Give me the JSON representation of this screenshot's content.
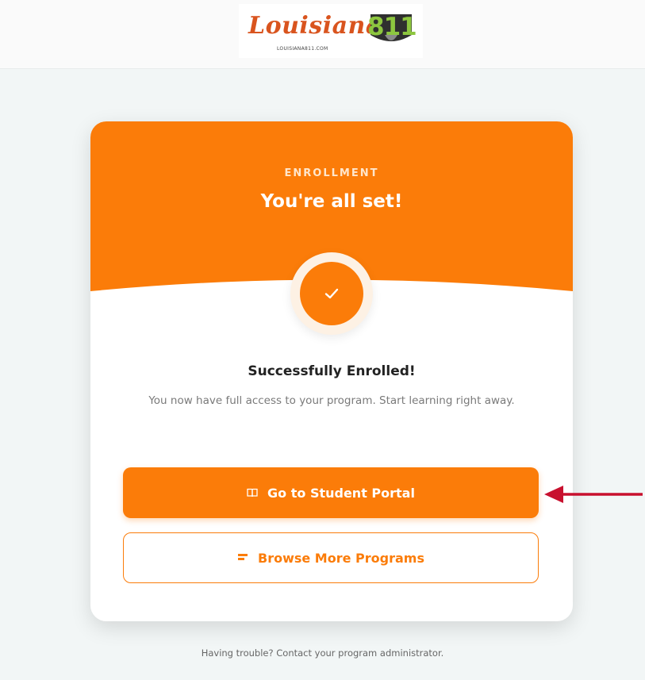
{
  "brand": {
    "logo_text": "Louisiana",
    "logo_badge": "811",
    "logo_url": "LOUISIANA811.COM"
  },
  "card": {
    "eyebrow": "ENROLLMENT",
    "title": "You're all set!",
    "success_title": "Successfully Enrolled!",
    "success_description": "You now have full access to your program. Start learning right away.",
    "primary_button_label": "Go to Student Portal",
    "secondary_button_label": "Browse More Programs"
  },
  "footer": {
    "help_text": "Having trouble? Contact your program administrator."
  },
  "colors": {
    "accent": "#fb7c09",
    "background": "#f2f6f6",
    "annotation_arrow": "#c8102e"
  },
  "icons": {
    "check": "check-icon",
    "portal": "book-icon",
    "browse": "list-icon"
  }
}
